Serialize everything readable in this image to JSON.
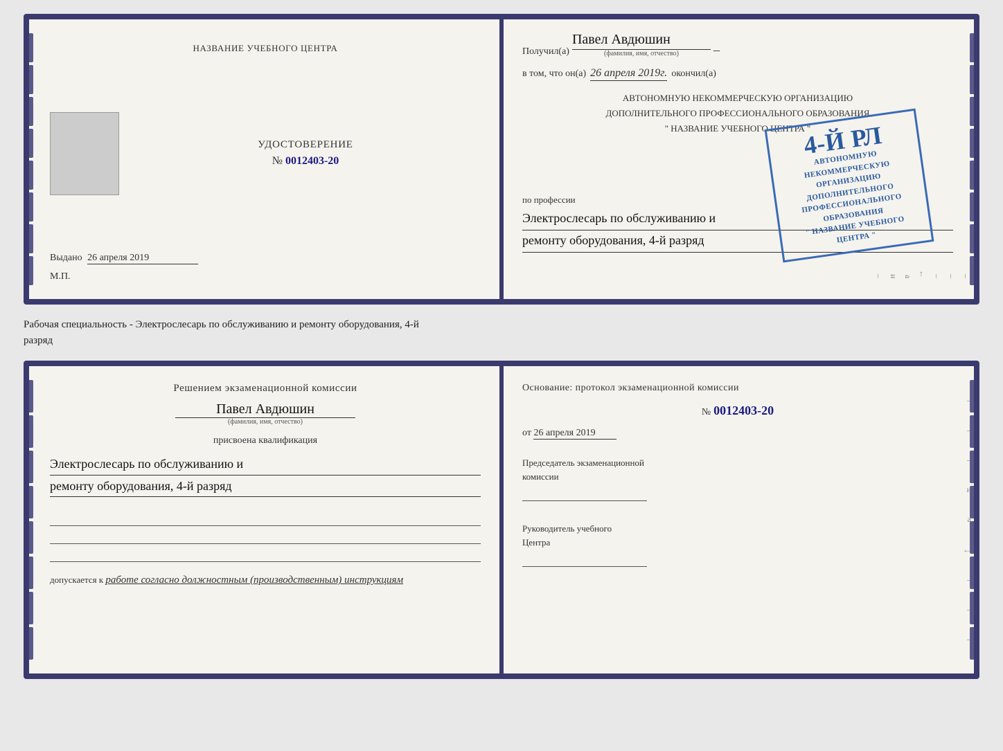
{
  "page": {
    "background": "#e8e8e8"
  },
  "top_doc": {
    "left": {
      "header": "НАЗВАНИЕ УЧЕБНОГО ЦЕНТРА",
      "cert_label": "УДОСТОВЕРЕНИЕ",
      "cert_number_prefix": "№",
      "cert_number": "0012403-20",
      "issued_label": "Выдано",
      "issued_date": "26 апреля 2019",
      "mp_label": "М.П."
    },
    "right": {
      "recipient_label": "Получил(а)",
      "recipient_name": "Павел Авдюшин",
      "recipient_fio_hint": "(фамилия, имя, отчество)",
      "date_label": "в том, что он(а)",
      "date_value": "26 апреля 2019г.",
      "finished_label": "окончил(а)",
      "stamp_line1": "АВТОНОМНУЮ НЕКОММЕРЧЕСКУЮ ОРГАНИЗАЦИЮ",
      "stamp_line2": "ДОПОЛНИТЕЛЬНОГО ПРОФЕССИОНАЛЬНОГО ОБРАЗОВАНИЯ",
      "stamp_line3": "\" НАЗВАНИЕ УЧЕБНОГО ЦЕНТРА \"",
      "stamp_number": "4-й рл",
      "profession_label": "по профессии",
      "profession_line1": "Электрослесарь по обслуживанию и",
      "profession_line2": "ремонту оборудования, 4-й разряд"
    }
  },
  "separator": {
    "text_line1": "Рабочая специальность - Электрослесарь по обслуживанию и ремонту оборудования, 4-й",
    "text_line2": "разряд"
  },
  "bottom_doc": {
    "left": {
      "decision_title": "Решением экзаменационной комиссии",
      "person_name": "Павел Авдюшин",
      "fio_hint": "(фамилия, имя, отчество)",
      "qualification_assigned": "присвоена квалификация",
      "qualification_line1": "Электрослесарь по обслуживанию и",
      "qualification_line2": "ремонту оборудования, 4-й разряд",
      "admission_label": "допускается к",
      "admission_text": "работе согласно должностным (производственным) инструкциям"
    },
    "right": {
      "osnov_label": "Основание: протокол экзаменационной комиссии",
      "number_prefix": "№",
      "number": "0012403-20",
      "date_prefix": "от",
      "date": "26 апреля 2019",
      "chairman_title": "Председатель экзаменационной\nкомиссии",
      "head_title": "Руководитель учебного\nЦентра"
    }
  }
}
